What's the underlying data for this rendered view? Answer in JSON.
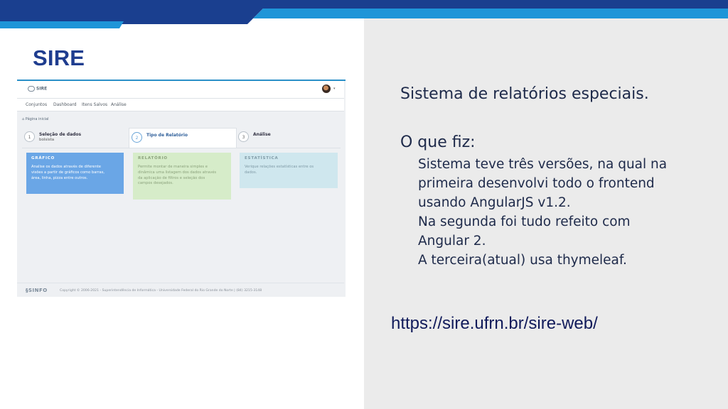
{
  "slide": {
    "title": "SIRE",
    "colors": {
      "ribbon_dark": "#1a3f8f",
      "ribbon_light": "#1f95d8",
      "title": "#1f3d8f",
      "right_panel": "#ebebeb"
    }
  },
  "screenshot": {
    "logo_text": "SIRE",
    "nav": [
      "Conjuntos",
      "Dashboard",
      "Itens Salvos",
      "Análise"
    ],
    "breadcrumb": "Página inicial",
    "steps": [
      {
        "num": "1",
        "label": "Seleção de dados",
        "sub": "bolsista"
      },
      {
        "num": "2",
        "label": "Tipo de Relatório",
        "sub": ""
      },
      {
        "num": "3",
        "label": "Análise",
        "sub": ""
      }
    ],
    "cards": [
      {
        "title": "GRÁFICO",
        "desc": [
          "Analise os dados através de diferente",
          "visões a partir de gráficos como barras,",
          "área, linha, pizza entre outros."
        ]
      },
      {
        "title": "RELATÓRIO",
        "desc": [
          "Permite montar de maneira simples e",
          "dinâmica uma listagem dos dados através",
          "da aplicação de filtros e seleção dos",
          "campos desejados."
        ]
      },
      {
        "title": "ESTATÍSTICA",
        "desc": [
          "Verique relações estatísticas entre os",
          "dados."
        ]
      }
    ],
    "footer_logo": "SINFO",
    "footer_text": "Copyright © 2006-2021 - Superintendência de Informática - Universidade Federal do Rio Grande do Norte  |  (84) 3215-3148"
  },
  "right": {
    "heading": "Sistema de relatórios especiais.",
    "subheading": "O que fiz:",
    "lines": [
      "Sistema teve três versões, na qual na",
      "primeira desenvolvi todo o frontend",
      "usando AngularJS v1.2.",
      "Na segunda foi tudo refeito com",
      "Angular 2.",
      "A terceira(atual) usa thymeleaf."
    ],
    "url": "https://sire.ufrn.br/sire-web/"
  }
}
